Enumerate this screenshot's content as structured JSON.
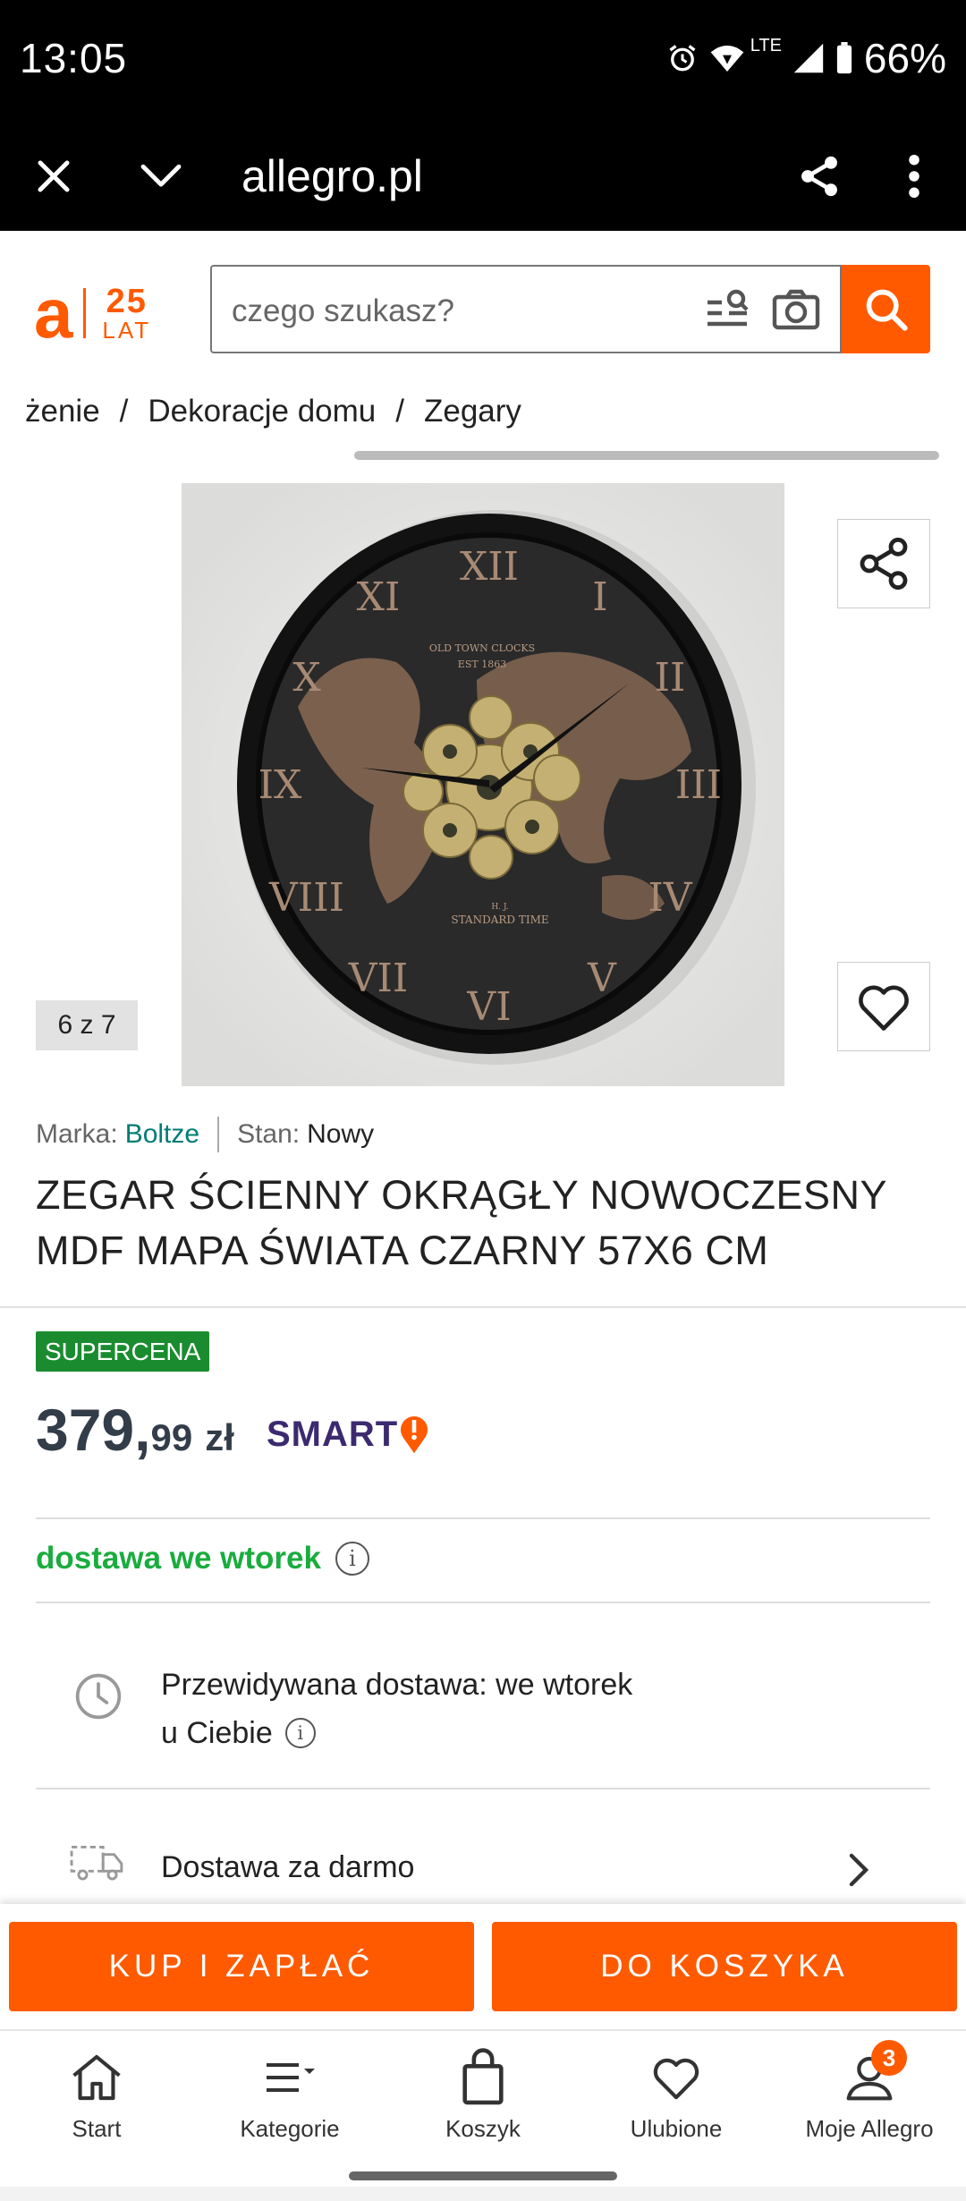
{
  "status_bar": {
    "time": "13:05",
    "network": "LTE",
    "battery": "66%"
  },
  "browser": {
    "url": "allegro.pl"
  },
  "header": {
    "logo_letter": "a",
    "logo_years": "25",
    "logo_lat": "LAT",
    "search_placeholder": "czego szukasz?"
  },
  "breadcrumb": {
    "items": [
      "żenie",
      "Dekoracje domu",
      "Zegary"
    ],
    "separator": "/"
  },
  "gallery": {
    "counter": "6 z 7",
    "clock_top_text": "OLD TOWN CLOCKS",
    "clock_est": "EST 1863",
    "clock_bottom_text": "STANDARD TIME",
    "clock_maker": "H. J."
  },
  "product": {
    "brand_label": "Marka:",
    "brand": "Boltze",
    "condition_label": "Stan:",
    "condition": "Nowy",
    "title_line1": "ZEGAR ŚCIENNY OKRĄGŁY NOWOCZESNY",
    "title_line2": "MDF MAPA ŚWIATA CZARNY 57X6 CM"
  },
  "pricing": {
    "badge": "SUPERCENA",
    "price_int": "379,",
    "price_dec": "99",
    "currency": "zł",
    "smart_label": "SMART"
  },
  "delivery": {
    "headline": "dostawa we wtorek",
    "predicted_line1": "Przewidywana dostawa: we wtorek",
    "predicted_line2": "u Ciebie",
    "free": "Dostawa za darmo"
  },
  "actions": {
    "buy_now": "KUP I ZAPŁAĆ",
    "add_to_cart": "DO KOSZYKA"
  },
  "bottom_nav": {
    "items": [
      {
        "label": "Start",
        "icon": "home-icon"
      },
      {
        "label": "Kategorie",
        "icon": "menu-icon"
      },
      {
        "label": "Koszyk",
        "icon": "cart-icon"
      },
      {
        "label": "Ulubione",
        "icon": "heart-icon"
      },
      {
        "label": "Moje Allegro",
        "icon": "user-icon",
        "badge": "3"
      }
    ]
  },
  "colors": {
    "brand_orange": "#ff5a00",
    "badge_green": "#1a8c2f",
    "delivery_green": "#1aac3e",
    "brand_teal": "#007c73",
    "smart_purple": "#3c2a70"
  }
}
